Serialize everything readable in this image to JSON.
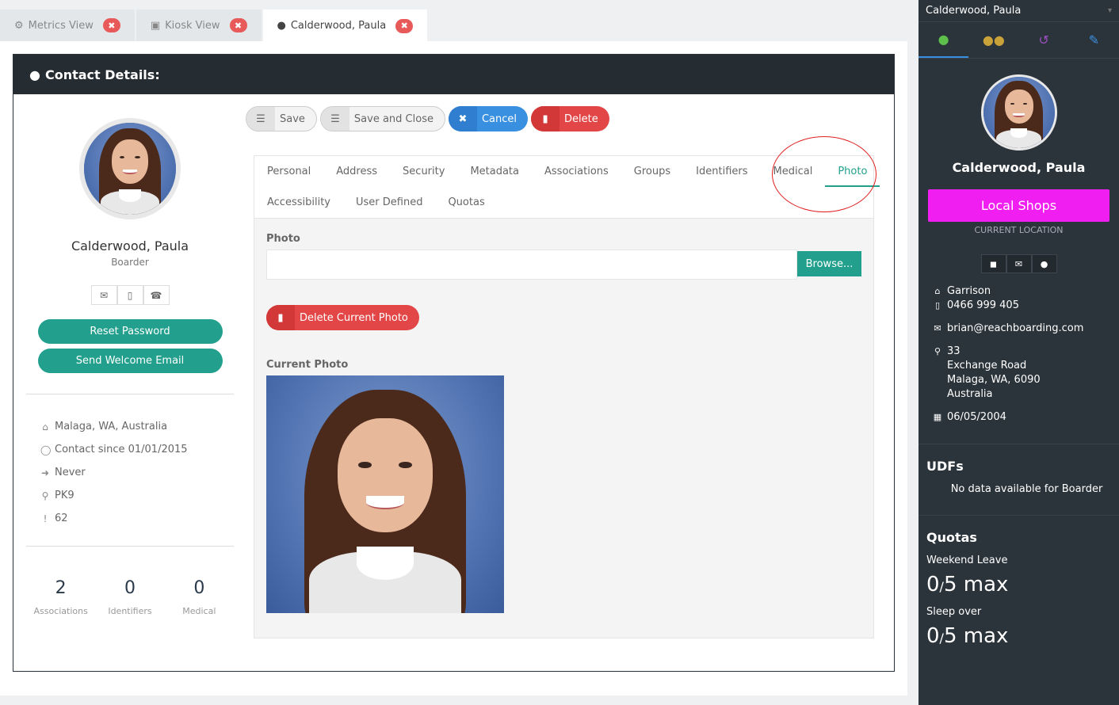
{
  "top_tabs": [
    {
      "icon": "dashboard-icon",
      "label": "Metrics View"
    },
    {
      "icon": "image-icon",
      "label": "Kiosk View"
    },
    {
      "icon": "user-icon",
      "label": "Calderwood, Paula"
    }
  ],
  "card": {
    "title": "Contact Details:"
  },
  "profile": {
    "name": "Calderwood, Paula",
    "role": "Boarder",
    "reset_password": "Reset Password",
    "send_welcome": "Send Welcome Email",
    "info": [
      {
        "icon": "home-icon",
        "text": "Malaga, WA, Australia"
      },
      {
        "icon": "clock-icon",
        "text": "Contact since 01/01/2015"
      },
      {
        "icon": "sign-in-icon",
        "text": "Never"
      },
      {
        "icon": "key-icon",
        "text": "PK9"
      },
      {
        "icon": "exclamation-icon",
        "text": "62"
      }
    ],
    "stats": [
      {
        "value": "2",
        "label": "Associations"
      },
      {
        "value": "0",
        "label": "Identifiers"
      },
      {
        "value": "0",
        "label": "Medical"
      }
    ]
  },
  "actions": {
    "save": "Save",
    "save_close": "Save and Close",
    "cancel": "Cancel",
    "delete": "Delete"
  },
  "tabs_row1": [
    "Personal",
    "Address",
    "Security",
    "Metadata",
    "Associations",
    "Groups",
    "Identifiers",
    "Medical",
    "Photo"
  ],
  "tabs_row2": [
    "Accessibility",
    "User Defined",
    "Quotas"
  ],
  "photo_tab": {
    "photo_label": "Photo",
    "browse": "Browse...",
    "delete_current": "Delete Current Photo",
    "current_label": "Current Photo"
  },
  "sidebar": {
    "header": "Calderwood, Paula",
    "name": "Calderwood, Paula",
    "location": "Local Shops",
    "location_sub": "CURRENT LOCATION",
    "house": "Garrison",
    "phone": "0466 999 405",
    "email": "brian@reachboarding.com",
    "address_line1": "33",
    "address_line2": "Exchange Road",
    "address_line3": "Malaga, WA, 6090",
    "address_line4": "Australia",
    "dob": "06/05/2004",
    "udfs_title": "UDFs",
    "udfs_empty": "No data available for Boarder",
    "quotas_title": "Quotas",
    "quotas": [
      {
        "name": "Weekend Leave",
        "used": "0",
        "max": "5 max"
      },
      {
        "name": "Sleep over",
        "used": "0",
        "max": "5 max"
      }
    ]
  },
  "colors": {
    "teal": "#22a08d",
    "blue": "#3a90e0",
    "red": "#e24646",
    "magenta": "#f01ef0",
    "dark": "#2c343b"
  }
}
